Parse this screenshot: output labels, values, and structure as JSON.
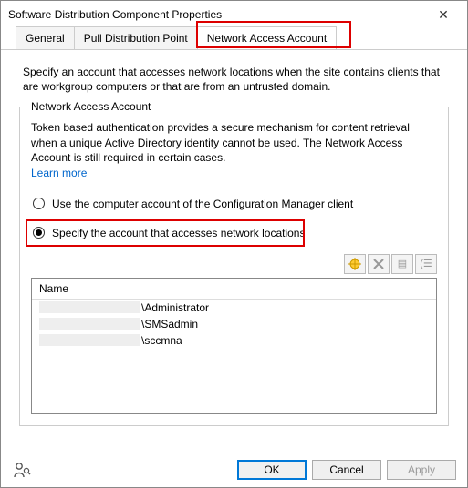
{
  "window": {
    "title": "Software Distribution Component Properties"
  },
  "tabs": {
    "general": "General",
    "pull_dp": "Pull Distribution Point",
    "naa": "Network Access Account"
  },
  "description": "Specify an account that accesses network locations when the site contains clients that are workgroup computers or that are from an untrusted domain.",
  "group": {
    "title": "Network Access Account",
    "desc": "Token based authentication provides a secure mechanism for content retrieval when a unique Active Directory identity cannot be used. The Network Access Account is still required in certain cases.",
    "learn_more": "Learn more",
    "radio_computer": "Use the computer account of the Configuration Manager client",
    "radio_specify": "Specify the account that accesses network locations"
  },
  "list": {
    "header": "Name",
    "rows": [
      {
        "suffix": "\\Administrator"
      },
      {
        "suffix": "\\SMSadmin"
      },
      {
        "suffix": "\\sccmna"
      }
    ]
  },
  "buttons": {
    "ok": "OK",
    "cancel": "Cancel",
    "apply": "Apply"
  }
}
